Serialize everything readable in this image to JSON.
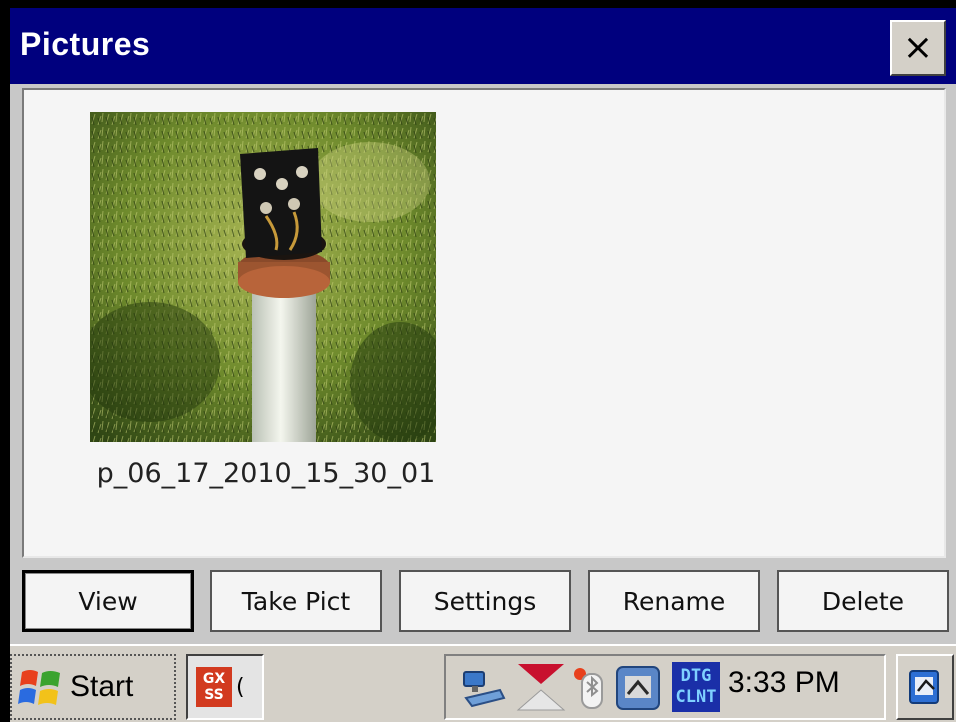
{
  "window": {
    "title": "Pictures",
    "close_glyph": "×"
  },
  "pictures": [
    {
      "name": "p_06_17_2010_15_30_01",
      "thumbnail_icon": "photo-thumbnail"
    }
  ],
  "buttons": {
    "view": "View",
    "take_pict": "Take Pict",
    "settings": "Settings",
    "rename": "Rename",
    "delete": "Delete"
  },
  "taskbar": {
    "start_label": "Start",
    "app": {
      "icon_text_top": "GX",
      "icon_text_bottom": "SS",
      "label": "("
    },
    "tray": {
      "clock": "3:33 PM",
      "dtg_top": "DTG",
      "dtg_bottom": "CLNT"
    }
  },
  "colors": {
    "titlebar": "#00007e",
    "taskbar": "#d4d0c8",
    "content_bg": "#f5f5f5"
  }
}
